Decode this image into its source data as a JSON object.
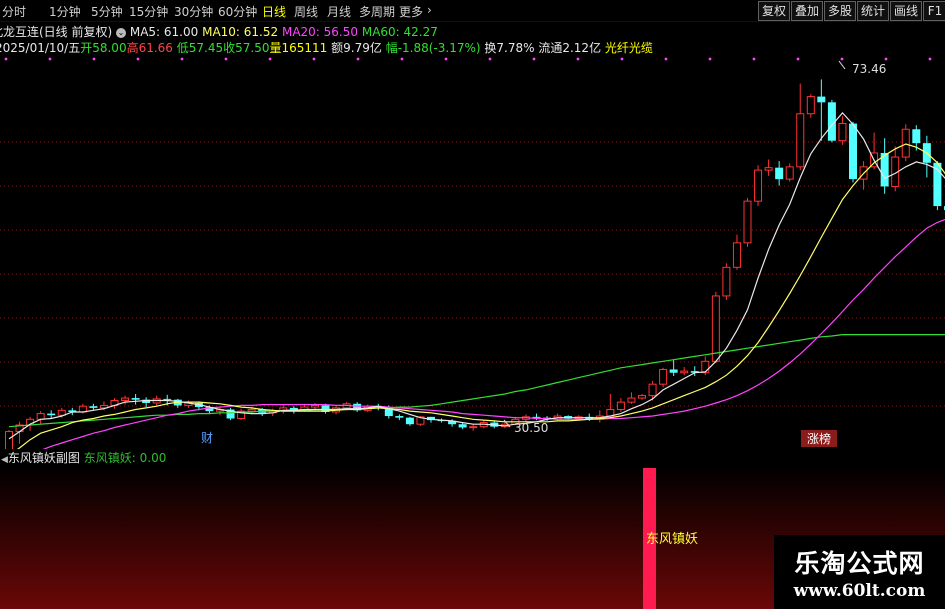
{
  "toolbar": {
    "periods": [
      "分时",
      "1分钟",
      "5分钟",
      "15分钟",
      "30分钟",
      "60分钟",
      "日线",
      "周线",
      "月线",
      "多周期",
      "更多"
    ],
    "active_period": "日线",
    "buttons": [
      "复权",
      "叠加",
      "多股",
      "统计",
      "画线",
      "F1"
    ]
  },
  "header": {
    "stock_name": "北龙互连(日线 前复权)",
    "ma5": "MA5: 61.00",
    "ma10": "MA10: 61.52",
    "ma20": "MA20: 56.50",
    "ma60": "MA60: 42.27"
  },
  "quote": {
    "date": "2025/01/10/五",
    "open": "开58.00",
    "high": "高61.66",
    "low": "低57.45",
    "close": "收57.50",
    "volume": "量165111",
    "amount": "额9.79亿",
    "change": "幅-1.88(-3.17%)",
    "turnover": "换7.78%",
    "float": "流通2.12亿",
    "concept": "光纤光缆"
  },
  "main_chart": {
    "max_label": "73.46",
    "min_label": "30.50",
    "marker_cai": "财",
    "marker_zhangbang": "涨榜"
  },
  "sub_chart": {
    "title": "东风镇妖副图",
    "indicator": "东风镇妖: 0.00",
    "signal_label": "东风镇妖"
  },
  "watermark": {
    "line1": "乐淘公式网",
    "line2": "www.60lt.com"
  },
  "colors": {
    "up": "#ff3232",
    "down": "#54ffff",
    "ma5": "#e8e8e8",
    "ma10": "#ffff66",
    "ma20": "#ff44ff",
    "ma60": "#33dd33",
    "signal": "#ff1a50"
  },
  "chart_data": {
    "type": "candlestick",
    "y_range": [
      29,
      76
    ],
    "candles": [
      [
        27.5,
        30.4,
        27.2,
        30.6
      ],
      [
        30.4,
        31.2,
        28.9,
        31.6
      ],
      [
        31.2,
        31.9,
        30.5,
        32.2
      ],
      [
        31.9,
        32.6,
        31.3,
        32.9
      ],
      [
        32.6,
        32.4,
        32.0,
        33.0
      ],
      [
        32.4,
        33.0,
        32.1,
        33.3
      ],
      [
        33.0,
        32.8,
        32.4,
        33.3
      ],
      [
        32.8,
        33.5,
        32.6,
        33.8
      ],
      [
        33.5,
        33.3,
        33.0,
        33.8
      ],
      [
        33.3,
        33.6,
        33.0,
        34.1
      ],
      [
        33.6,
        34.2,
        33.2,
        34.5
      ],
      [
        34.2,
        34.5,
        33.7,
        34.8
      ],
      [
        34.5,
        34.3,
        33.7,
        35.0
      ],
      [
        34.3,
        33.9,
        33.4,
        34.6
      ],
      [
        33.9,
        34.4,
        33.5,
        34.8
      ],
      [
        34.4,
        34.3,
        33.6,
        34.9
      ],
      [
        34.3,
        33.6,
        33.3,
        34.4
      ],
      [
        33.6,
        33.9,
        33.3,
        34.2
      ],
      [
        33.9,
        33.4,
        33.0,
        34.1
      ],
      [
        33.4,
        32.9,
        32.6,
        33.6
      ],
      [
        32.9,
        33.1,
        32.4,
        33.3
      ],
      [
        33.1,
        32.0,
        31.8,
        33.3
      ],
      [
        32.0,
        32.9,
        31.8,
        33.2
      ],
      [
        32.9,
        33.1,
        32.5,
        33.4
      ],
      [
        33.1,
        32.7,
        32.3,
        33.3
      ],
      [
        32.7,
        32.9,
        32.3,
        33.2
      ],
      [
        32.9,
        33.3,
        32.6,
        33.6
      ],
      [
        33.3,
        33.0,
        32.6,
        33.5
      ],
      [
        33.0,
        33.4,
        32.8,
        33.8
      ],
      [
        33.4,
        33.6,
        33.0,
        33.9
      ],
      [
        33.6,
        32.8,
        32.6,
        33.8
      ],
      [
        32.8,
        33.3,
        32.5,
        33.5
      ],
      [
        33.3,
        33.8,
        33.0,
        34.0
      ],
      [
        33.8,
        33.0,
        32.8,
        34.0
      ],
      [
        33.0,
        33.5,
        32.8,
        33.7
      ],
      [
        33.5,
        33.4,
        33.0,
        33.8
      ],
      [
        33.4,
        32.3,
        32.0,
        33.6
      ],
      [
        32.3,
        32.1,
        31.8,
        32.5
      ],
      [
        32.1,
        31.3,
        31.1,
        32.2
      ],
      [
        31.3,
        32.2,
        31.1,
        32.3
      ],
      [
        32.2,
        31.8,
        31.5,
        32.2
      ],
      [
        31.8,
        31.7,
        31.5,
        32.0
      ],
      [
        31.7,
        31.3,
        31.0,
        31.9
      ],
      [
        31.3,
        30.9,
        30.7,
        31.5
      ],
      [
        30.9,
        31.0,
        30.5,
        31.3
      ],
      [
        31.0,
        31.5,
        30.8,
        31.8
      ],
      [
        31.5,
        31.0,
        30.8,
        31.7
      ],
      [
        31.0,
        31.3,
        30.8,
        31.5
      ],
      [
        31.3,
        31.9,
        31.2,
        32.2
      ],
      [
        31.9,
        32.2,
        31.6,
        32.5
      ],
      [
        32.2,
        32.1,
        31.8,
        32.6
      ],
      [
        32.1,
        31.9,
        31.7,
        32.3
      ],
      [
        31.9,
        32.3,
        31.7,
        32.6
      ],
      [
        32.3,
        32.0,
        31.8,
        32.4
      ],
      [
        32.0,
        32.2,
        31.8,
        32.4
      ],
      [
        32.2,
        31.9,
        31.7,
        32.6
      ],
      [
        31.9,
        32.3,
        31.5,
        33.0
      ],
      [
        32.3,
        33.1,
        32.0,
        35.0
      ],
      [
        33.1,
        34.0,
        32.8,
        34.5
      ],
      [
        34.0,
        34.5,
        33.8,
        35.2
      ],
      [
        34.5,
        34.8,
        34.3,
        35.0
      ],
      [
        34.8,
        36.2,
        34.2,
        36.6
      ],
      [
        36.2,
        38.0,
        35.8,
        38.2
      ],
      [
        38.0,
        37.6,
        37.2,
        39.2
      ],
      [
        37.6,
        37.8,
        37.3,
        38.3
      ],
      [
        37.8,
        37.6,
        37.2,
        38.4
      ],
      [
        37.6,
        39.0,
        37.3,
        39.6
      ],
      [
        39.0,
        47.0,
        38.8,
        47.5
      ],
      [
        47.0,
        50.5,
        46.5,
        51.0
      ],
      [
        50.5,
        53.5,
        50.2,
        54.5
      ],
      [
        53.5,
        58.6,
        53.0,
        59.0
      ],
      [
        58.6,
        62.4,
        58.0,
        63.0
      ],
      [
        62.4,
        62.7,
        61.7,
        63.7
      ],
      [
        62.7,
        61.3,
        60.5,
        63.5
      ],
      [
        61.3,
        62.8,
        61.0,
        63.2
      ],
      [
        62.8,
        69.3,
        62.4,
        73.0
      ],
      [
        69.3,
        71.4,
        68.8,
        71.7
      ],
      [
        71.4,
        70.7,
        66.0,
        73.5
      ],
      [
        70.7,
        66.0,
        65.8,
        71.0
      ],
      [
        66.0,
        68.1,
        65.5,
        69.0
      ],
      [
        68.1,
        61.3,
        60.9,
        68.3
      ],
      [
        61.3,
        62.8,
        60.0,
        63.5
      ],
      [
        62.8,
        64.5,
        62.5,
        67.0
      ],
      [
        64.5,
        60.4,
        59.5,
        66.3
      ],
      [
        60.4,
        64.0,
        59.8,
        65.3
      ],
      [
        64.0,
        67.4,
        63.5,
        68.0
      ],
      [
        67.4,
        65.7,
        64.8,
        67.9
      ],
      [
        65.7,
        63.3,
        61.5,
        66.6
      ],
      [
        63.3,
        58.0,
        57.5,
        63.5
      ],
      [
        58.0,
        57.5,
        57.0,
        61.7
      ]
    ],
    "ma5": [
      29.5,
      30.4,
      31.3,
      31.9,
      32.0,
      32.3,
      32.8,
      32.8,
      33.0,
      33.2,
      33.6,
      34.0,
      34.1,
      34.2,
      34.2,
      34.2,
      34.1,
      33.9,
      33.7,
      33.4,
      33.1,
      32.9,
      32.7,
      32.6,
      32.6,
      32.7,
      33.0,
      33.0,
      33.1,
      33.1,
      33.1,
      33.1,
      33.2,
      33.2,
      33.3,
      33.5,
      33.2,
      32.9,
      32.5,
      32.1,
      31.9,
      31.8,
      31.7,
      31.5,
      31.3,
      31.3,
      31.2,
      31.1,
      31.3,
      31.4,
      31.6,
      31.9,
      32.1,
      32.1,
      32.1,
      32.1,
      32.1,
      32.3,
      32.6,
      33.2,
      33.7,
      34.4,
      35.5,
      36.2,
      36.9,
      37.6,
      37.7,
      39.0,
      40.6,
      42.8,
      45.3,
      49.2,
      52.7,
      55.7,
      58.2,
      61.5,
      64.4,
      66.3,
      67.9,
      69.4,
      68.0,
      66.2,
      63.6,
      61.4,
      62.0,
      62.8,
      63.4,
      63.1,
      62.5,
      61.0
    ],
    "ma10": [
      27.5,
      28.4,
      29.4,
      30.2,
      30.6,
      31.0,
      31.5,
      31.8,
      32.0,
      32.3,
      32.5,
      32.8,
      33.1,
      33.3,
      33.5,
      33.8,
      34.0,
      34.0,
      34.0,
      33.9,
      33.8,
      33.6,
      33.4,
      33.3,
      33.1,
      33.0,
      32.9,
      32.9,
      32.9,
      32.9,
      32.9,
      33.0,
      33.1,
      33.1,
      33.2,
      33.3,
      33.2,
      33.1,
      32.9,
      32.8,
      32.7,
      32.5,
      32.3,
      32.1,
      31.9,
      31.8,
      31.7,
      31.6,
      31.6,
      31.6,
      31.6,
      31.6,
      31.7,
      31.7,
      31.8,
      31.9,
      32.0,
      32.1,
      32.3,
      32.6,
      32.9,
      33.3,
      33.8,
      34.3,
      34.8,
      35.3,
      35.8,
      36.5,
      37.3,
      38.4,
      39.7,
      41.3,
      43.2,
      45.2,
      47.3,
      49.5,
      51.8,
      54.2,
      56.5,
      58.8,
      60.5,
      62.0,
      63.3,
      64.2,
      65.0,
      65.6,
      65.2,
      64.5,
      63.3,
      61.5
    ],
    "ma20": [
      27.0,
      27.3,
      27.7,
      28.1,
      28.6,
      29.0,
      29.4,
      29.8,
      30.2,
      30.5,
      30.9,
      31.2,
      31.5,
      31.8,
      32.1,
      32.4,
      32.6,
      32.9,
      33.1,
      33.3,
      33.4,
      33.5,
      33.6,
      33.6,
      33.7,
      33.7,
      33.7,
      33.7,
      33.7,
      33.7,
      33.7,
      33.6,
      33.6,
      33.5,
      33.5,
      33.5,
      33.4,
      33.3,
      33.2,
      33.1,
      33.0,
      32.9,
      32.8,
      32.6,
      32.5,
      32.4,
      32.3,
      32.2,
      32.1,
      32.1,
      32.0,
      32.0,
      31.9,
      31.9,
      31.9,
      31.9,
      31.9,
      32.0,
      32.0,
      32.1,
      32.2,
      32.3,
      32.5,
      32.7,
      32.9,
      33.2,
      33.5,
      33.9,
      34.3,
      34.8,
      35.4,
      36.1,
      36.9,
      37.8,
      38.8,
      39.9,
      41.1,
      42.4,
      43.7,
      45.1,
      46.5,
      47.8,
      49.2,
      50.5,
      51.8,
      53.0,
      54.2,
      55.3,
      56.0,
      56.5
    ],
    "ma60": [
      31.0,
      31.1,
      31.2,
      31.3,
      31.4,
      31.5,
      31.6,
      31.7,
      31.8,
      31.9,
      32.0,
      32.1,
      32.2,
      32.3,
      32.4,
      32.4,
      32.5,
      32.5,
      32.6,
      32.6,
      32.7,
      32.7,
      32.8,
      32.8,
      32.9,
      32.9,
      33.0,
      33.0,
      33.0,
      33.1,
      33.1,
      33.1,
      33.2,
      33.2,
      33.2,
      33.3,
      33.3,
      33.4,
      33.4,
      33.5,
      33.6,
      33.8,
      34.0,
      34.2,
      34.4,
      34.6,
      34.8,
      35.0,
      35.3,
      35.5,
      35.8,
      36.1,
      36.4,
      36.7,
      37.0,
      37.3,
      37.6,
      37.9,
      38.2,
      38.4,
      38.6,
      38.8,
      39.0,
      39.2,
      39.4,
      39.6,
      39.8,
      40.0,
      40.2,
      40.4,
      40.6,
      40.8,
      41.0,
      41.2,
      41.4,
      41.6,
      41.8,
      42.0,
      42.1,
      42.27,
      42.27,
      42.27,
      42.27,
      42.27,
      42.27,
      42.27,
      42.27,
      42.27,
      42.27,
      42.27
    ]
  }
}
